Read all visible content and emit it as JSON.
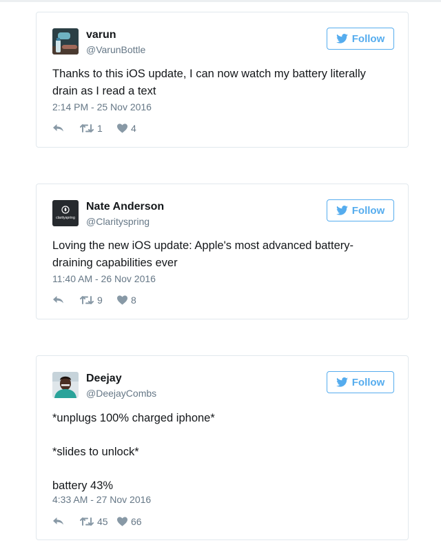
{
  "colors": {
    "accent": "#55acee",
    "text": "#14171a",
    "muted": "#657786",
    "icon": "#8899a6",
    "border": "#e1e8ed"
  },
  "tweets": [
    {
      "name": "varun",
      "handle": "@VarunBottle",
      "avatar_icon": "bottle-photo-avatar",
      "follow_label": "Follow",
      "text_lines": [
        "Thanks to this iOS update, I can now watch my battery literally",
        "drain as I read a text"
      ],
      "timestamp": "2:14 PM - 25 Nov 2016",
      "retweets": "1",
      "likes": "4"
    },
    {
      "name": "Nate Anderson",
      "handle": "@Clarityspring",
      "avatar_icon": "clarityspring-logo-avatar",
      "avatar_text": "clarityspring",
      "follow_label": "Follow",
      "text_lines": [
        "Loving the new iOS update: Apple's most advanced battery-",
        "draining capabilities ever"
      ],
      "timestamp": "11:40 AM - 26 Nov 2016",
      "retweets": "9",
      "likes": "8"
    },
    {
      "name": "Deejay",
      "handle": "@DeejayCombs",
      "avatar_icon": "person-photo-avatar",
      "follow_label": "Follow",
      "text_lines": [
        "*unplugs 100% charged iphone*",
        "*slides to unlock*",
        "battery 43%"
      ],
      "timestamp": "4:33 AM - 27 Nov 2016",
      "retweets": "45",
      "likes": "66"
    }
  ]
}
